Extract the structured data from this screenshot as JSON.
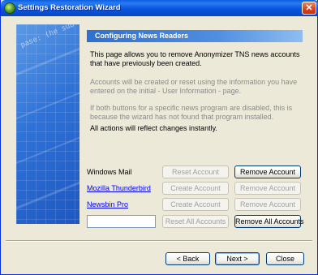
{
  "window": {
    "title": "Settings Restoration Wizard"
  },
  "side_panel": {
    "art_text": "pase: (he sub"
  },
  "header": {
    "title": "Configuring News Readers"
  },
  "paragraphs": [
    "This page allows you to remove Anonymizer TNS news accounts that have previously been created.",
    "Accounts will be created or reset using the information you have entered on the initial - User Information - page.",
    "If both buttons for a specific news program are disabled, this is because the wizard has not found that program installed.",
    "All actions will reflect changes instantly."
  ],
  "rows": [
    {
      "label": "Windows Mail",
      "is_link": false,
      "left_button": "Reset Account",
      "left_enabled": false,
      "right_button": "Remove Account",
      "right_enabled": true
    },
    {
      "label": "Mozilla Thunderbird",
      "is_link": true,
      "left_button": "Create Account",
      "left_enabled": false,
      "right_button": "Remove Account",
      "right_enabled": false
    },
    {
      "label": "Newsbin Pro",
      "is_link": true,
      "left_button": "Create Account",
      "left_enabled": false,
      "right_button": "Remove Account",
      "right_enabled": false
    }
  ],
  "bulk": {
    "input_value": "",
    "reset_all_label": "Reset All Accounts",
    "reset_all_enabled": false,
    "remove_all_label": "Remove All Accounts",
    "remove_all_enabled": true
  },
  "footer": {
    "back_label": "< Back",
    "next_label": "Next >",
    "close_label": "Close"
  }
}
